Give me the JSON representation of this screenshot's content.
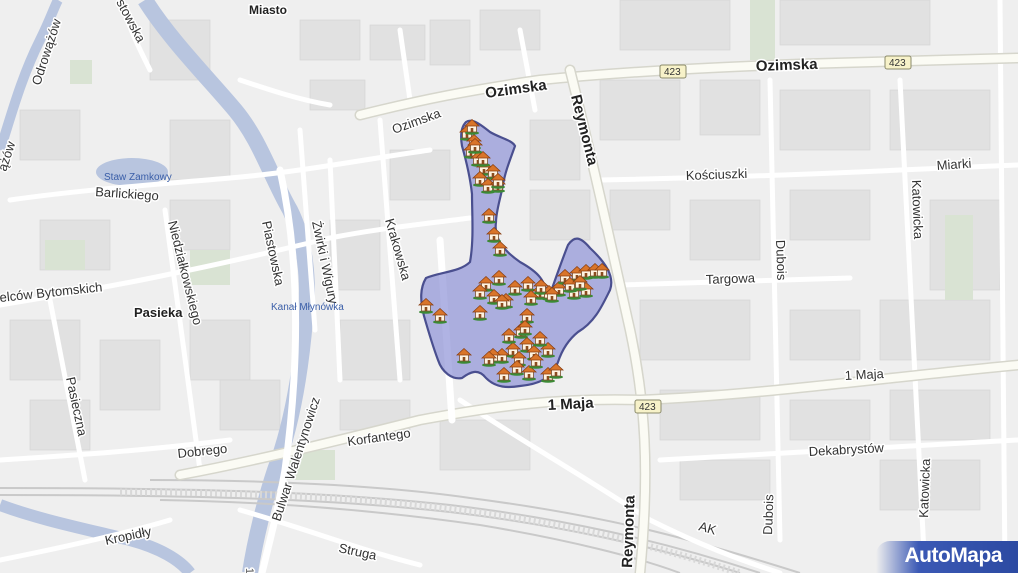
{
  "map": {
    "streets": {
      "ozimska_top": "Ozimska",
      "ozimska_right": "Ozimska",
      "ozimska_left": "Ozimska",
      "reymonta_top": "Reymonta",
      "reymonta_bottom": "Reymonta",
      "maja_main": "1 Maja",
      "maja_right": "1 Maja",
      "koscuszki": "Kościuszki",
      "miarki": "Miarki",
      "targowa": "Targowa",
      "dubois_top": "Dubois",
      "dubois_bottom": "Dubois",
      "katowicka_top": "Katowicka",
      "katowicka_bottom": "Katowicka",
      "krakowska": "Krakowska",
      "zwirki": "Żwirki i Wigury",
      "piastowska": "Piastowska",
      "niedzialkowskiego": "Niedziałkowskiego",
      "barlickiego": "Barlickiego",
      "bytomskich": "elców Bytomskich",
      "pasieczna": "Pasieczna",
      "dobrego": "Dobrego",
      "korfantego": "Korfantego",
      "walentynowicz": "Bulwar Walentynowicz",
      "kropidly": "Kropidły",
      "struga": "Struga",
      "dekabrystow": "Dekabrystów",
      "odrowazow": "Odrowążów",
      "azow": "ążów",
      "ostowska": "stowska",
      "ak": "AK",
      "one": "1"
    },
    "places": {
      "miasto": "Miasto",
      "pasieka": "Pasieka",
      "staw": "Staw Zamkowy",
      "kanal": "Kanał Młynówka"
    },
    "route_shields": [
      "423",
      "423",
      "423"
    ],
    "marker_count_estimate": 62,
    "colors": {
      "background": "#f2f2f2",
      "water": "#b8c5df",
      "area_fill": "#8a8fd6",
      "area_stroke": "#4a4f8f",
      "brand": "#2c4aa2"
    }
  },
  "brand": {
    "logo_text": "AutoMapa"
  }
}
